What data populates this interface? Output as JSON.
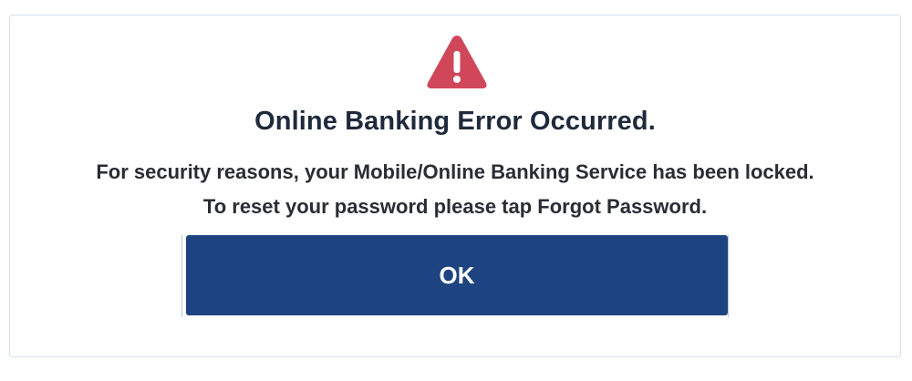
{
  "dialog": {
    "icon": "warning-triangle-icon",
    "icon_color": "#d0475a",
    "title": "Online Banking Error Occurred.",
    "message_line1": "For security reasons, your Mobile/Online Banking Service has been locked.",
    "message_line2": "To reset your password please tap Forgot Password.",
    "ok_label": "OK",
    "button_color": "#1d4480"
  }
}
